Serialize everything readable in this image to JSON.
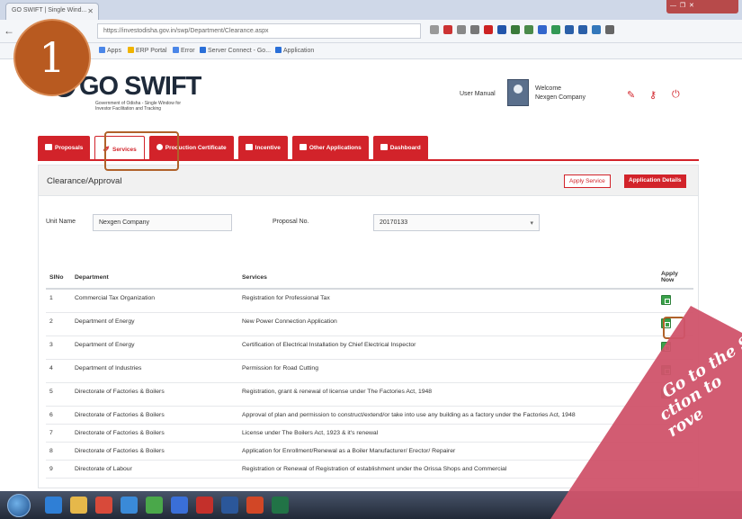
{
  "browser": {
    "tab_title": "GO SWIFT | Single Wind...",
    "url": "https://investodisha.gov.in/swp/Department/Clearance.aspx",
    "bookmarks": [
      {
        "label": "Apps",
        "color": "#4a86e8"
      },
      {
        "label": "ERP Portal",
        "color": "#f0b400"
      },
      {
        "label": "Error",
        "color": "#4a86e8"
      },
      {
        "label": "Server Connect - Go...",
        "color": "#2a6fd8"
      },
      {
        "label": "Application",
        "color": "#2a6fd8"
      }
    ]
  },
  "header": {
    "logo_text": "GO SWIFT",
    "logo_subtitle": "Government of Odisha - Single Window for Investor Facilitation and Tracking",
    "user_manual": "User Manual",
    "welcome_label": "Welcome",
    "company_name": "Nexgen Company"
  },
  "tabs": [
    {
      "label": "Proposals",
      "icon": "proposals-icon",
      "active": false
    },
    {
      "label": "Services",
      "icon": "services-icon",
      "active": true
    },
    {
      "label": "Production Certificate",
      "icon": "certificate-icon",
      "active": false
    },
    {
      "label": "Incentive",
      "icon": "incentive-icon",
      "active": false
    },
    {
      "label": "Other Applications",
      "icon": "grid-icon",
      "active": false
    },
    {
      "label": "Dashboard",
      "icon": "dashboard-icon",
      "active": false
    }
  ],
  "panel": {
    "title": "Clearance/Approval",
    "apply_service_button": "Apply Service",
    "application_details_button": "Application Details",
    "unit_name_label": "Unit Name",
    "unit_name_value": "Nexgen Company",
    "proposal_no_label": "Proposal No.",
    "proposal_no_value": "20170133"
  },
  "table": {
    "headers": [
      "SlNo",
      "Department",
      "Services",
      "Apply Now"
    ],
    "rows": [
      {
        "slno": "1",
        "department": "Commercial Tax Organization",
        "service": "Registration for Professional Tax"
      },
      {
        "slno": "2",
        "department": "Department of Energy",
        "service": "New Power Connection Application"
      },
      {
        "slno": "3",
        "department": "Department of Energy",
        "service": "Certification of Electrical Installation by Chief Electrical Inspector"
      },
      {
        "slno": "4",
        "department": "Department of Industries",
        "service": "Permission for Road Cutting"
      },
      {
        "slno": "5",
        "department": "Directorate of Factories & Boilers",
        "service": "Registration, grant & renewal of license under The Factories Act, 1948"
      },
      {
        "slno": "6",
        "department": "Directorate of Factories & Boilers",
        "service": "Approval of plan and permission to construct/extend/or take into use any building as a factory under the Factories Act, 1948"
      },
      {
        "slno": "7",
        "department": "Directorate of Factories & Boilers",
        "service": "License under The Boilers Act, 1923 & it's renewal"
      },
      {
        "slno": "8",
        "department": "Directorate of Factories & Boilers",
        "service": "Application for Enrollment/Renewal as a Boiler Manufacturer/ Erector/ Repairer"
      },
      {
        "slno": "9",
        "department": "Directorate of Labour",
        "service": "Registration or Renewal of Registration of establishment under the Orissa Shops and Commercial"
      }
    ]
  },
  "tutorial": {
    "step_number": "1",
    "callout_line1": "Go to the Se",
    "callout_line2": "ction to",
    "callout_line3": "rove"
  },
  "colors": {
    "brand_red": "#d2232a",
    "apply_green": "#3aa14a",
    "highlight_brown": "#b0622a",
    "callout_pink": "#d0536a"
  }
}
